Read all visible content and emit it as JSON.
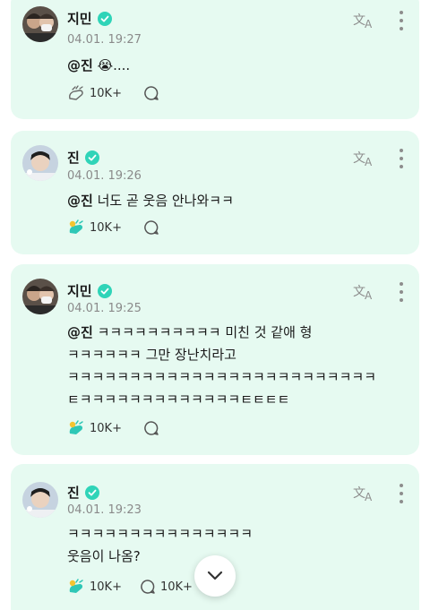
{
  "posts": [
    {
      "author": "지민",
      "time": "04.01. 19:27",
      "mention": "@진",
      "lines": [
        " 😭...."
      ],
      "likes": "10K+",
      "comments": ""
    },
    {
      "author": "진",
      "time": "04.01. 19:26",
      "mention": "@진",
      "lines": [
        " 너도 곧 웃음 안나와ㅋㅋ"
      ],
      "likes": "10K+",
      "comments": ""
    },
    {
      "author": "지민",
      "time": "04.01. 19:25",
      "mention": "@진",
      "lines": [
        " ㅋㅋㅋㅋㅋㅋㅋㅋㅋㅋ 미친 것 같애 형",
        "ㅋㅋㅋㅋㅋㅋ 그만 장난치라고",
        "ㅋㅋㅋㅋㅋㅋㅋㅋㅋㅋㅋㅋㅋㅋㅋㅋㅋㅋㅋㅋㅋㅋㅋㅋㅋ",
        "ㅌㅋㅋㅋㅋㅋㅋㅋㅋㅋㅋㅋㅋㅋㅌㅌㅌㅌ"
      ],
      "likes": "10K+",
      "comments": ""
    },
    {
      "author": "진",
      "time": "04.01. 19:23",
      "mention": "",
      "lines": [
        "ㅋㅋㅋㅋㅋㅋㅋㅋㅋㅋㅋㅋㅋㅋㅋ",
        "웃음이 나옴?"
      ],
      "likes": "10K+",
      "comments": "10K+"
    }
  ],
  "colors": {
    "card_bg": "#e6faf1",
    "verified": "#2fd4b8",
    "like_teal": "#2ec7b6",
    "like_yellow": "#f4c430"
  },
  "icons": {
    "verified": "verified-check-icon",
    "translate": "translate-icon",
    "more": "more-vertical-icon",
    "like_outline": "like-outline-icon",
    "like_filled": "like-filled-icon",
    "comment": "comment-bubble-icon",
    "scroll": "chevron-down-icon"
  }
}
